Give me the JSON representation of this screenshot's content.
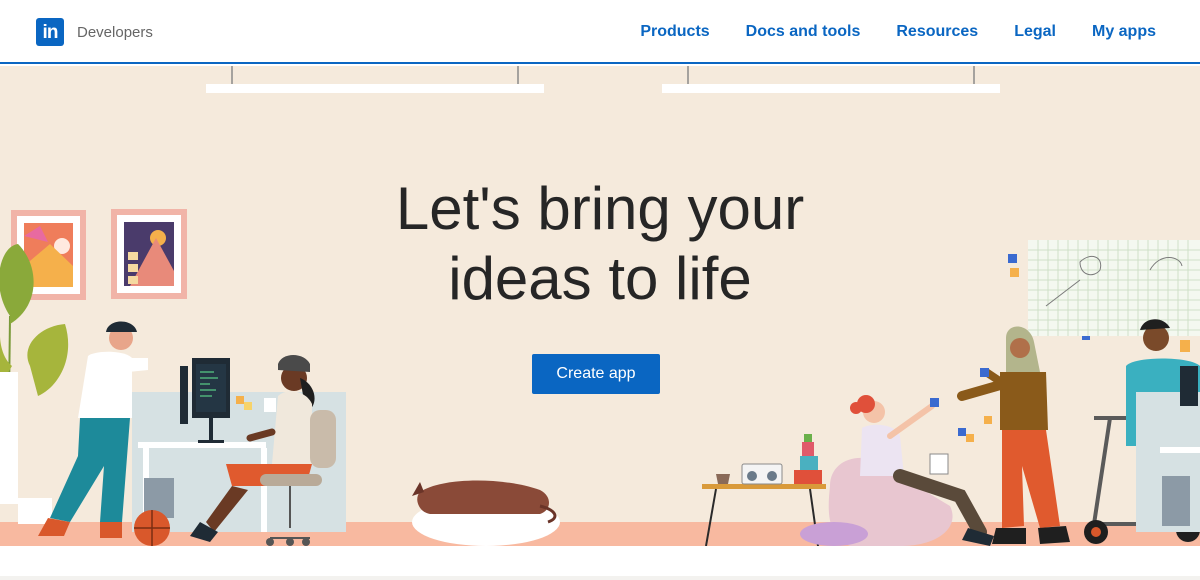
{
  "header": {
    "logo_text": "in",
    "brand_label": "Developers",
    "nav": [
      {
        "label": "Products"
      },
      {
        "label": "Docs and tools"
      },
      {
        "label": "Resources"
      },
      {
        "label": "Legal"
      },
      {
        "label": "My apps"
      }
    ]
  },
  "hero": {
    "headline_line1": "Let's bring your",
    "headline_line2": "ideas to life",
    "cta_label": "Create app"
  },
  "colors": {
    "brand_blue": "#0a66c2",
    "hero_bg": "#f5eadc",
    "floor": "#f8b9a0"
  }
}
